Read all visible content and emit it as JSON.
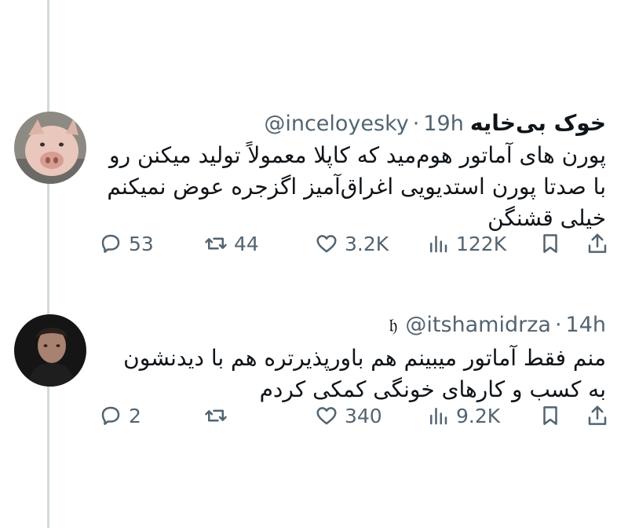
{
  "tweets": [
    {
      "display_name": "خوک بی‌خایه",
      "handle": "@inceloyesky",
      "separator": "·",
      "time": "19h",
      "lines": [
        "پورن های آماتور هوم‌مید که کاپلا معمولاً تولید میکنن رو",
        "با صدتا پورن استدیویی اغراق‌آمیز اگزجره عوض نمیکنم",
        "خیلی قشنگن"
      ],
      "replies": "53",
      "reposts": "44",
      "likes": "3.2K",
      "views": "122K",
      "avatar_icon": "pig-avatar"
    },
    {
      "prefix_glyph": "𝔥",
      "handle": "@itshamidrza",
      "separator": "·",
      "time": "14h",
      "lines": [
        "منم فقط آماتور میبینم هم باورپذیرتره هم با دیدنشون",
        "به کسب و کارهای خونگی کمکی کردم"
      ],
      "replies": "2",
      "reposts": "",
      "likes": "340",
      "views": "9.2K",
      "avatar_icon": "person-avatar"
    }
  ],
  "colors": {
    "text": "#0f1419",
    "secondary": "#536471",
    "thread_line": "#cfd9de"
  },
  "icons": [
    "reply-icon",
    "repost-icon",
    "like-icon",
    "views-icon",
    "bookmark-icon",
    "share-icon"
  ]
}
